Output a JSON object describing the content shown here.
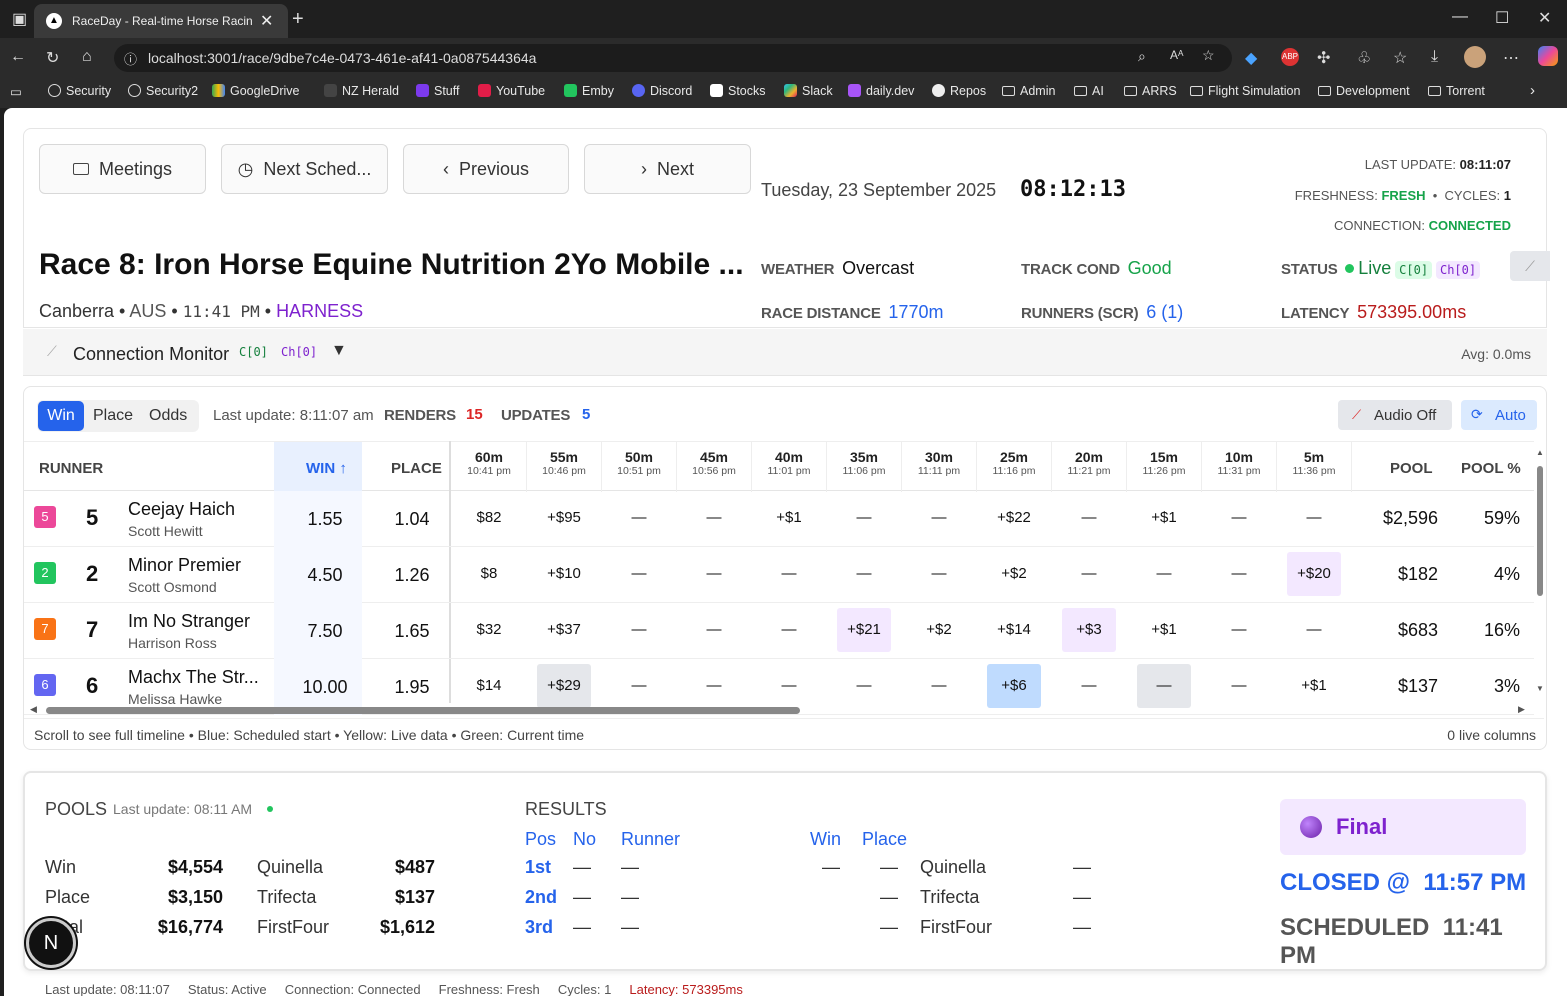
{
  "browser": {
    "tab_title": "RaceDay - Real-time Horse Racin",
    "url": "localhost:3001/race/9dbe7c4e-0473-461e-af41-0a087544364a",
    "bookmarks": [
      "Security",
      "Security2",
      "GoogleDrive",
      "NZ Herald",
      "Stuff",
      "YouTube",
      "Emby",
      "Discord",
      "Stocks",
      "Slack",
      "daily.dev",
      "Repos",
      "Admin",
      "AI",
      "ARRS",
      "Flight Simulation",
      "Development",
      "Torrent"
    ]
  },
  "nav": {
    "meetings": "Meetings",
    "next_scheduled": "Next Sched...",
    "previous": "Previous",
    "next": "Next"
  },
  "header": {
    "date": "Tuesday, 23 September 2025",
    "clock": "08:12:13",
    "last_update_label": "LAST UPDATE:",
    "last_update": "08:11:07",
    "freshness_label": "FRESHNESS:",
    "freshness": "FRESH",
    "cycles_label": "CYCLES:",
    "cycles": "1",
    "connection_label": "CONNECTION:",
    "connection": "CONNECTED",
    "race_title": "Race 8: Iron Horse Equine Nutrition 2Yo Mobile ...",
    "venue": "Canberra",
    "country": "AUS",
    "time": "11:41 PM",
    "type": "HARNESS",
    "weather_label": "WEATHER",
    "weather": "Overcast",
    "track_label": "TRACK COND",
    "track": "Good",
    "status_label": "STATUS",
    "status": "Live",
    "chip_c": "C[0]",
    "chip_ch": "Ch[0]",
    "distance_label": "RACE DISTANCE",
    "distance": "1770m",
    "runners_label": "RUNNERS (SCR)",
    "runners": "6 (1)",
    "latency_label": "LATENCY",
    "latency": "573395.00ms"
  },
  "monitor": {
    "title": "Connection Monitor",
    "c": "C[0]",
    "ch": "Ch[0]",
    "avg": "Avg: 0.0ms"
  },
  "toolbar": {
    "win": "Win",
    "place": "Place",
    "odds": "Odds",
    "last_update": "Last update: 8:11:07 am",
    "renders_label": "RENDERS",
    "renders": "15",
    "updates_label": "UPDATES",
    "updates": "5",
    "audio": "Audio Off",
    "auto": "Auto"
  },
  "table": {
    "headers": {
      "runner": "RUNNER",
      "win": "WIN ↑",
      "place": "PLACE",
      "pool": "POOL",
      "pool_pct": "POOL %"
    },
    "timeline": [
      {
        "m": "60m",
        "t": "10:41 pm"
      },
      {
        "m": "55m",
        "t": "10:46 pm"
      },
      {
        "m": "50m",
        "t": "10:51 pm"
      },
      {
        "m": "45m",
        "t": "10:56 pm"
      },
      {
        "m": "40m",
        "t": "11:01 pm"
      },
      {
        "m": "35m",
        "t": "11:06 pm"
      },
      {
        "m": "30m",
        "t": "11:11 pm"
      },
      {
        "m": "25m",
        "t": "11:16 pm"
      },
      {
        "m": "20m",
        "t": "11:21 pm"
      },
      {
        "m": "15m",
        "t": "11:26 pm"
      },
      {
        "m": "10m",
        "t": "11:31 pm"
      },
      {
        "m": "5m",
        "t": "11:36 pm"
      }
    ],
    "rows": [
      {
        "badge": "5",
        "badge_color": "#ec4899",
        "num": "5",
        "name": "Ceejay Haich",
        "driver": "Scott Hewitt",
        "win": "1.55",
        "place": "1.04",
        "cells": [
          "$82",
          "+$95",
          "—",
          "—",
          "+$1",
          "—",
          "—",
          "+$22",
          "—",
          "+$1",
          "—",
          "—"
        ],
        "highlights": [
          "",
          "",
          "",
          "",
          "",
          "",
          "",
          "",
          "",
          "",
          "",
          ""
        ],
        "pool": "$2,596",
        "pct": "59%"
      },
      {
        "badge": "2",
        "badge_color": "#22c55e",
        "num": "2",
        "name": "Minor Premier",
        "driver": "Scott Osmond",
        "win": "4.50",
        "place": "1.26",
        "cells": [
          "$8",
          "+$10",
          "—",
          "—",
          "—",
          "—",
          "—",
          "+$2",
          "—",
          "—",
          "—",
          "+$20"
        ],
        "highlights": [
          "",
          "",
          "",
          "",
          "",
          "",
          "",
          "",
          "",
          "",
          "",
          "#f3e8ff"
        ],
        "pool": "$182",
        "pct": "4%"
      },
      {
        "badge": "7",
        "badge_color": "#f97316",
        "num": "7",
        "name": "Im No Stranger",
        "driver": "Harrison Ross",
        "win": "7.50",
        "place": "1.65",
        "cells": [
          "$32",
          "+$37",
          "—",
          "—",
          "—",
          "+$21",
          "+$2",
          "+$14",
          "+$3",
          "+$1",
          "—",
          "—"
        ],
        "highlights": [
          "",
          "",
          "",
          "",
          "",
          "#f3e8ff",
          "",
          "",
          "#f3e8ff",
          "",
          "",
          ""
        ],
        "pool": "$683",
        "pct": "16%"
      },
      {
        "badge": "6",
        "badge_color": "#6366f1",
        "num": "6",
        "name": "Machx The Str...",
        "driver": "Melissa Hawke",
        "win": "10.00",
        "place": "1.95",
        "cells": [
          "$14",
          "+$29",
          "—",
          "—",
          "—",
          "—",
          "—",
          "+$6",
          "—",
          "—",
          "—",
          "+$1"
        ],
        "highlights": [
          "",
          "#e5e7eb",
          "",
          "",
          "",
          "",
          "",
          "#bfdbfe",
          "",
          "#e5e7eb",
          "",
          ""
        ],
        "pool": "$137",
        "pct": "3%"
      }
    ],
    "footer_note": "Scroll to see full timeline • Blue: Scheduled start • Yellow: Live data • Green: Current time",
    "live_columns": "0 live columns"
  },
  "pools": {
    "title": "POOLS",
    "last_update": "Last update: 08:11 AM",
    "items": [
      {
        "label": "Win",
        "value": "$4,554",
        "label2": "Quinella",
        "value2": "$487"
      },
      {
        "label": "Place",
        "value": "$3,150",
        "label2": "Trifecta",
        "value2": "$137"
      },
      {
        "label": "Total",
        "value": "$16,774",
        "label2": "FirstFour",
        "value2": "$1,612"
      }
    ]
  },
  "results": {
    "title": "RESULTS",
    "pos": "Pos",
    "no": "No",
    "runner": "Runner",
    "win": "Win",
    "place": "Place",
    "rows": [
      {
        "pos": "1st",
        "no": "—",
        "runner": "—",
        "win": "—",
        "place": "—",
        "exotic": "Quinella",
        "exotic_val": "—"
      },
      {
        "pos": "2nd",
        "no": "—",
        "runner": "—",
        "win": "",
        "place": "—",
        "exotic": "Trifecta",
        "exotic_val": "—"
      },
      {
        "pos": "3rd",
        "no": "—",
        "runner": "—",
        "win": "",
        "place": "—",
        "exotic": "FirstFour",
        "exotic_val": "—"
      }
    ]
  },
  "final": {
    "status": "Final",
    "closed_label": "CLOSED @",
    "closed": "11:57 PM",
    "scheduled_label": "SCHEDULED",
    "scheduled": "11:41 PM"
  },
  "status_bar": {
    "last_update": "Last update: 08:11:07",
    "status": "Status: Active",
    "connection": "Connection: Connected",
    "freshness": "Freshness: Fresh",
    "cycles": "Cycles: 1",
    "latency": "Latency: 573395ms"
  }
}
